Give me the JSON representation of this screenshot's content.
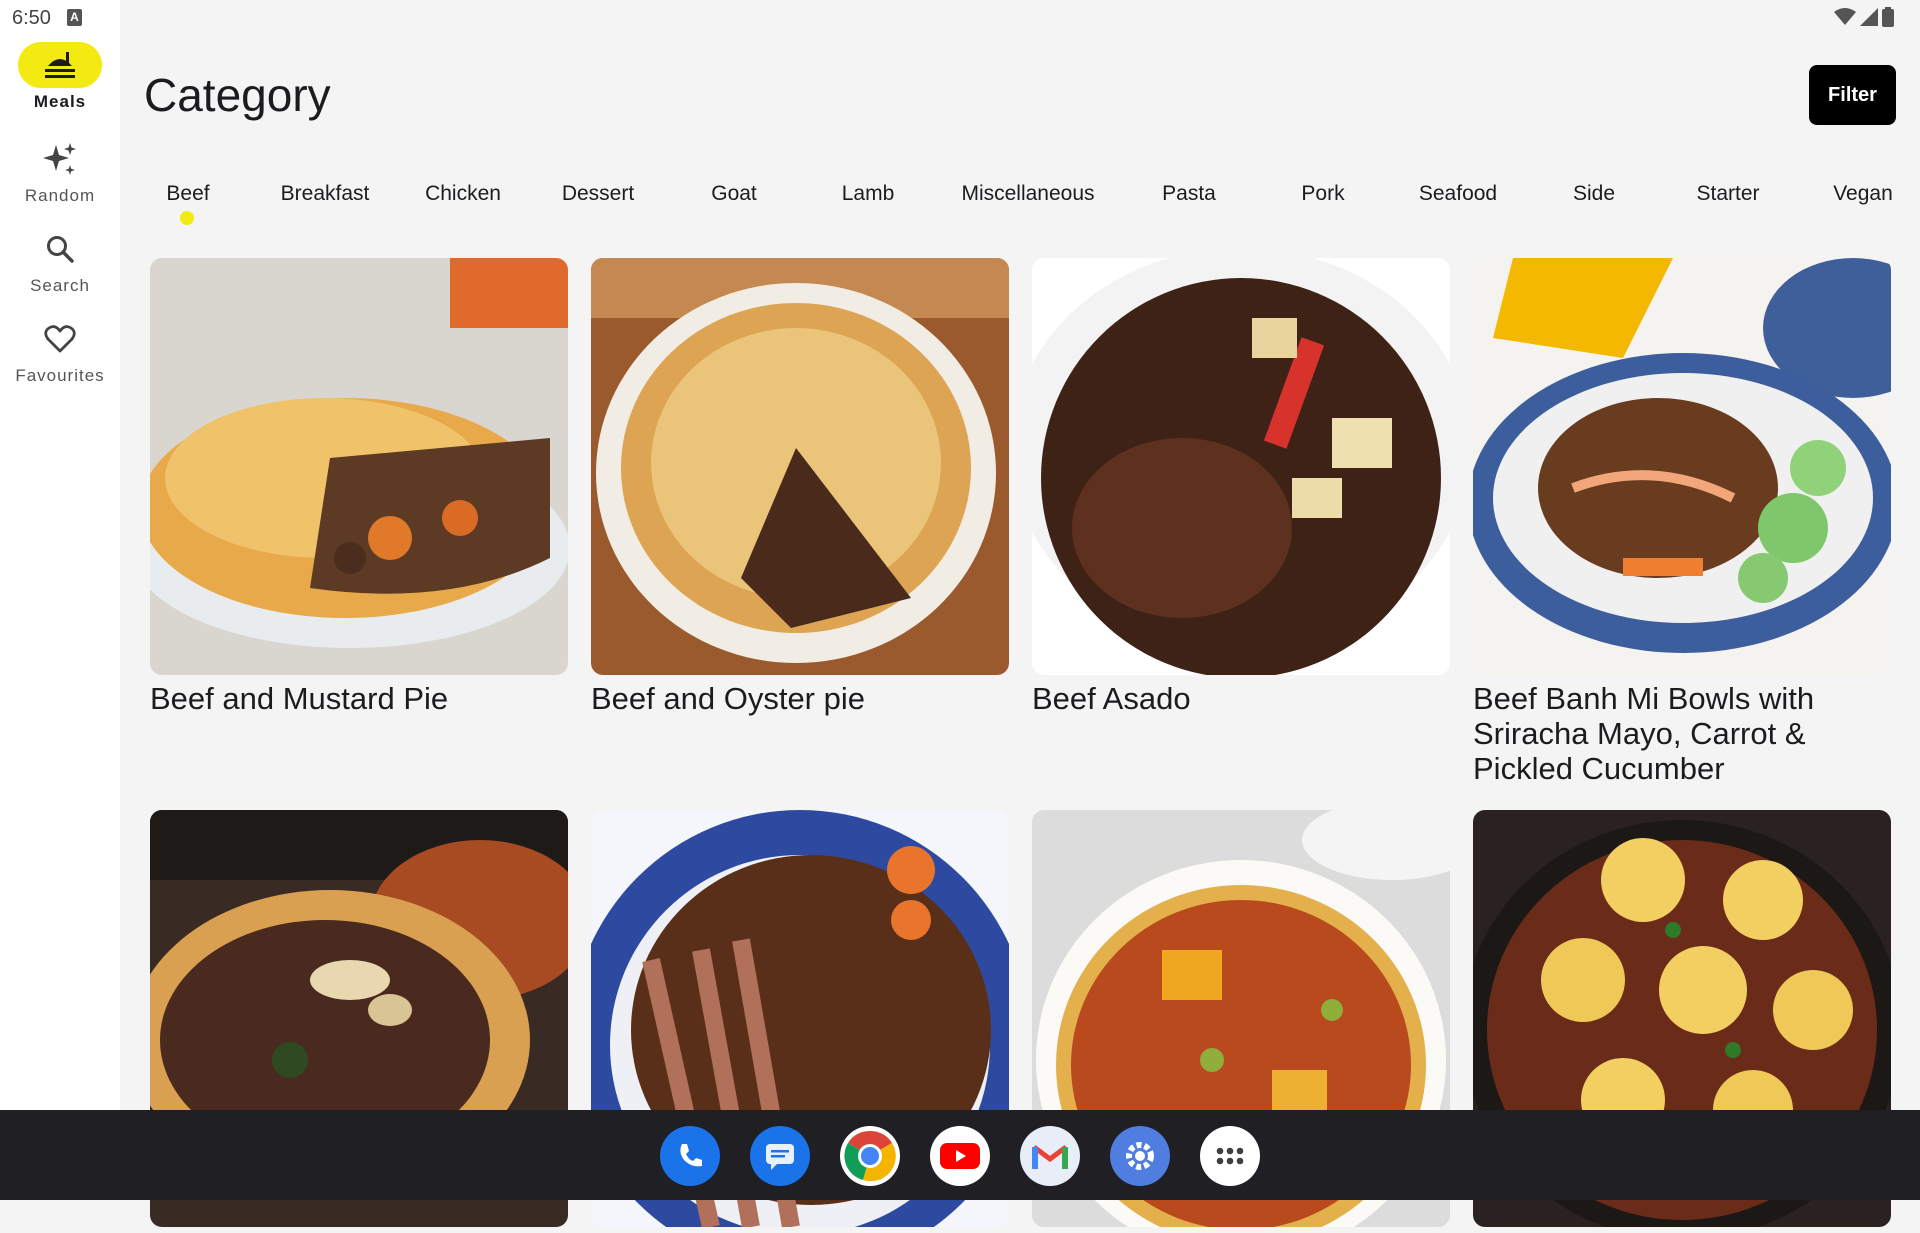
{
  "status": {
    "time": "6:50",
    "indicator": "A"
  },
  "nav": {
    "items": [
      {
        "label": "Meals",
        "icon": "meals-icon",
        "active": true
      },
      {
        "label": "Random",
        "icon": "sparkle-icon"
      },
      {
        "label": "Search",
        "icon": "search-icon"
      },
      {
        "label": "Favourites",
        "icon": "heart-icon"
      }
    ]
  },
  "header": {
    "title": "Category",
    "filter_label": "Filter"
  },
  "tabs": [
    "Beef",
    "Breakfast",
    "Chicken",
    "Dessert",
    "Goat",
    "Lamb",
    "Miscellaneous",
    "Pasta",
    "Pork",
    "Seafood",
    "Side",
    "Starter",
    "Vegan"
  ],
  "active_tab": "Beef",
  "meals": [
    {
      "title": "Beef and Mustard Pie"
    },
    {
      "title": "Beef and Oyster pie"
    },
    {
      "title": "Beef Asado"
    },
    {
      "title": "Beef Banh Mi Bowls with Sriracha Mayo, Carrot & Pickled Cucumber"
    },
    {
      "title": ""
    },
    {
      "title": ""
    },
    {
      "title": ""
    },
    {
      "title": ""
    }
  ],
  "dock": [
    "phone-icon",
    "messages-icon",
    "chrome-icon",
    "youtube-icon",
    "gmail-icon",
    "settings-icon",
    "apps-icon"
  ],
  "colors": {
    "accent": "#f2ea10",
    "filter_bg": "#000000",
    "taskbar": "#1f1f24"
  }
}
